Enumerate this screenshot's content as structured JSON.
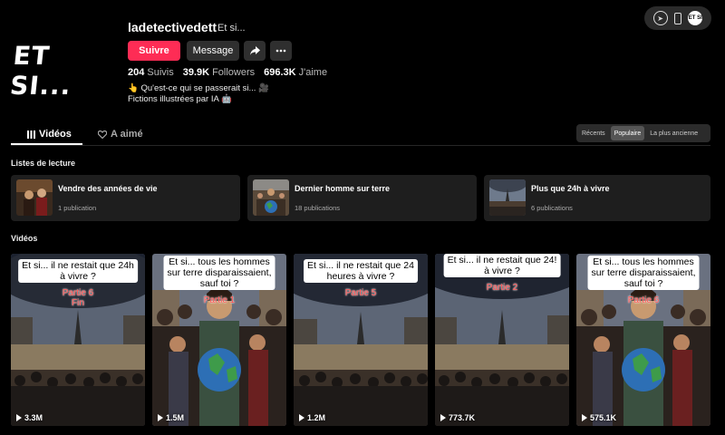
{
  "profile": {
    "avatar_text": "ET SI...",
    "username": "ladetectivedett",
    "nickname": "Et si...",
    "follow_label": "Suivre",
    "message_label": "Message",
    "stats": [
      {
        "value": "204",
        "label": "Suivis"
      },
      {
        "value": "39.9K",
        "label": "Followers"
      },
      {
        "value": "696.3K",
        "label": "J'aime"
      }
    ],
    "bio_line1": "👆 Qu'est-ce qui se passerait si... 🎥",
    "bio_line2": "Fictions illustrées par IA 🤖"
  },
  "tabs": {
    "videos": "Vidéos",
    "liked": "A aimé"
  },
  "sort": {
    "options": [
      "Récents",
      "Populaire",
      "La plus ancienne"
    ],
    "selected": "Populaire"
  },
  "playlists": {
    "heading": "Listes de lecture",
    "items": [
      {
        "title": "Vendre des années de vie",
        "count": "1 publication"
      },
      {
        "title": "Dernier homme sur terre",
        "count": "18 publications"
      },
      {
        "title": "Plus que 24h à vivre",
        "count": "6 publications"
      }
    ]
  },
  "videos": {
    "heading": "Vidéos",
    "items": [
      {
        "caption": "Et si... il ne restait que 24h\nà vivre ?",
        "part": "Partie 6\nFin",
        "plays": "3.3M",
        "scene": "paris"
      },
      {
        "caption": "Et si... tous les hommes\nsur terre disparaissaient,\nsauf toi ?",
        "part": "Partie 1",
        "plays": "1.5M",
        "scene": "earth"
      },
      {
        "caption": "Et si... il ne restait que 24\nheures à vivre ?",
        "part": "Partie 5",
        "plays": "1.2M",
        "scene": "paris"
      },
      {
        "caption": "Et si... il ne restait que 24!\nà vivre ?",
        "part": "Partie 2",
        "plays": "773.7K",
        "scene": "paris"
      },
      {
        "caption": "Et si... tous les hommes\nsur terre disparaissaient,\nsauf toi ?",
        "part": "Partie 6",
        "plays": "575.1K",
        "scene": "earth"
      }
    ]
  },
  "colors": {
    "accent": "#fe2c55",
    "background": "#000000",
    "card": "#1e1e1e"
  }
}
